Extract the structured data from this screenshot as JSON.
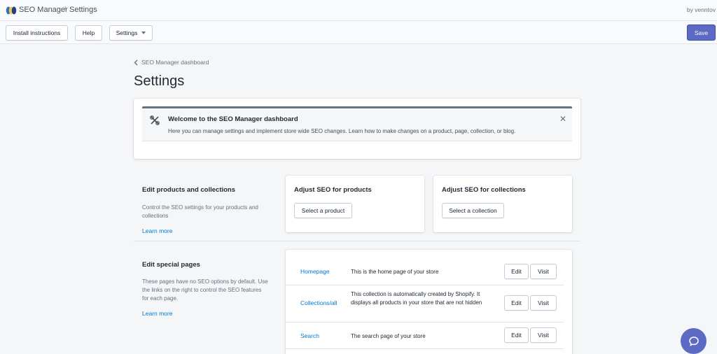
{
  "titlebar": {
    "app_name": "SEO Manager",
    "separator": "/",
    "crumb": "Settings",
    "byline": "by venntov",
    "logo_colors": [
      "#2c6ecb",
      "#f2c94c",
      "#1f3d8a"
    ]
  },
  "toolbar": {
    "install_label": "Install instructions",
    "help_label": "Help",
    "settings_label": "Settings",
    "save_label": "Save"
  },
  "page": {
    "back_label": "SEO Manager dashboard",
    "title": "Settings"
  },
  "banner": {
    "title": "Welcome to the SEO Manager dashboard",
    "text": "Here you can manage settings and implement store wide SEO changes. Learn how to make changes on a product, page, collection, or blog.",
    "close_glyph": "✕"
  },
  "products_section": {
    "title": "Edit products and collections",
    "description": "Control the SEO settings for your products and collections",
    "learn_more": "Learn more",
    "products_card": {
      "title": "Adjust SEO for products",
      "button": "Select a product"
    },
    "collections_card": {
      "title": "Adjust SEO for collections",
      "button": "Select a collection"
    }
  },
  "special_section": {
    "title": "Edit special pages",
    "description": "These pages have no SEO options by default. Use the links on the right to control the SEO features for each page.",
    "learn_more": "Learn more",
    "rows": [
      {
        "name": "Homepage",
        "description": "This is the home page of your store",
        "edit": "Edit",
        "visit": "Visit"
      },
      {
        "name": "Collections/all",
        "description": "This collection is automatically created by Shopify. It displays all products in your store that are not hidden",
        "edit": "Edit",
        "visit": "Visit"
      },
      {
        "name": "Search",
        "description": "The search page of your store",
        "edit": "Edit",
        "visit": "Visit"
      }
    ]
  },
  "colors": {
    "accent": "#5c6ac4",
    "link": "#007ace",
    "background": "#f4f6f8"
  },
  "icons": {
    "back": "chevron-left-icon",
    "banner": "tools-icon",
    "close": "close-icon",
    "dropdown": "caret-down-icon",
    "help_fab": "chat-bubble-icon"
  }
}
